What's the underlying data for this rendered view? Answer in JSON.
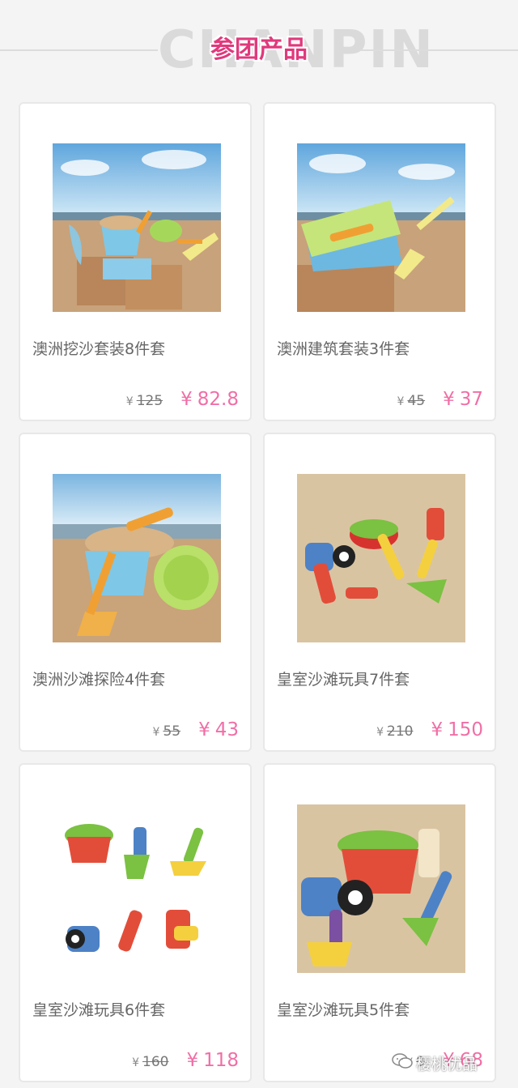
{
  "header": {
    "bg_text": "CHANPIN",
    "title": "参团产品"
  },
  "products": [
    {
      "name": "澳洲挖沙套装8件套",
      "currency": "¥",
      "old_price": "125",
      "new_price": "82.8",
      "image": "sand-bucket-set-image"
    },
    {
      "name": "澳洲建筑套装3件套",
      "currency": "¥",
      "old_price": "45",
      "new_price": "37",
      "image": "brick-mold-set-image"
    },
    {
      "name": "澳洲沙滩探险4件套",
      "currency": "¥",
      "old_price": "55",
      "new_price": "43",
      "image": "sieve-bucket-set-image"
    },
    {
      "name": "皇室沙滩玩具7件套",
      "currency": "¥",
      "old_price": "210",
      "new_price": "150",
      "image": "royal-7-piece-image"
    },
    {
      "name": "皇室沙滩玩具6件套",
      "currency": "¥",
      "old_price": "160",
      "new_price": "118",
      "image": "royal-6-piece-image"
    },
    {
      "name": "皇室沙滩玩具5件套",
      "currency": "¥",
      "old_price": "9",
      "new_price": "68",
      "image": "royal-5-piece-image"
    }
  ],
  "watermark": {
    "text": "樱桃优品",
    "icon": "wechat-icon"
  },
  "colors": {
    "accent": "#f06fa6",
    "title": "#e0397c"
  }
}
